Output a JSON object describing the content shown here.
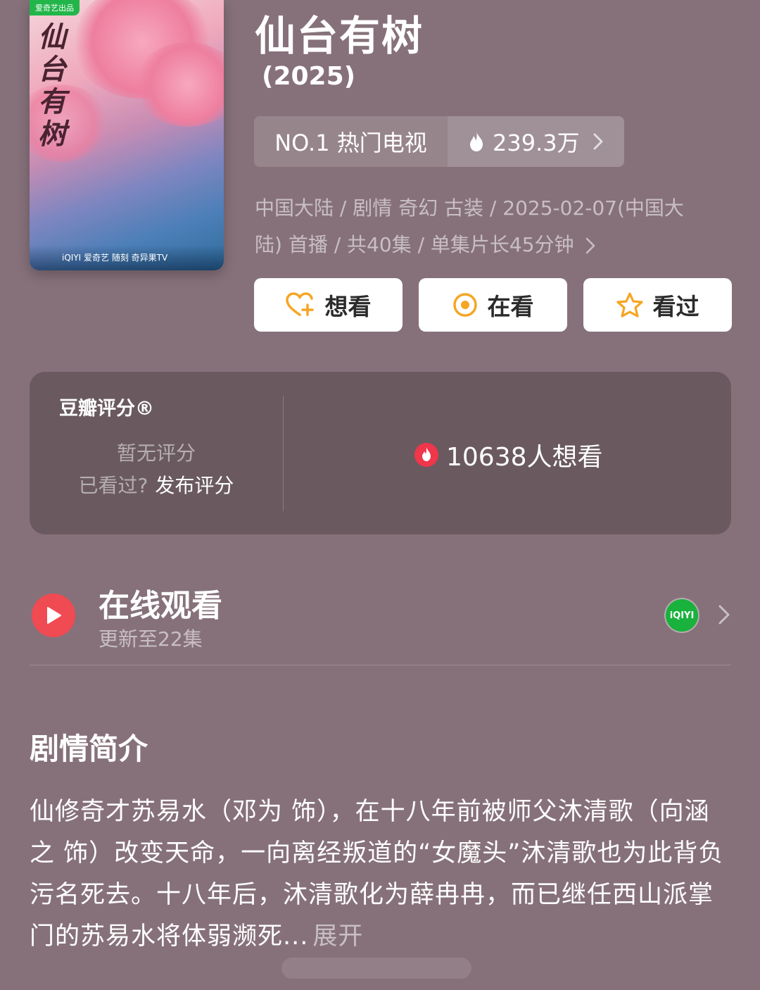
{
  "poster": {
    "badge": "爱奇艺出品",
    "title": "仙台有树",
    "bottom_text": "iQIYI 爱奇艺  随刻  奇异果TV"
  },
  "header": {
    "title": "仙台有树",
    "year": "(2025)"
  },
  "rank": {
    "label": "NO.1 热门电视",
    "heat": "239.3万"
  },
  "meta": {
    "line1": "中国大陆 / 剧情 奇幻 古装 / 2025-02-07(中国大",
    "line2": "陆) 首播 / 共40集 / 单集片长45分钟"
  },
  "actions": {
    "want": "想看",
    "watching": "在看",
    "watched": "看过"
  },
  "rating": {
    "label": "豆瓣评分®",
    "none": "暂无评分",
    "watched_q": "已看过?",
    "publish": "发布评分",
    "want_count": "10638人想看"
  },
  "online": {
    "title": "在线观看",
    "subtitle": "更新至22集",
    "provider": "iQIYI"
  },
  "synopsis": {
    "heading": "剧情简介",
    "text": "仙修奇才苏易水（邓为 饰），在十八年前被师父沐清歌（向涵之 饰）改变天命，一向离经叛道的“女魔头”沐清歌也为此背负污名死去。十八年后，沐清歌化为薛冉冉，而已继任西山派掌门的苏易水将体弱濒死...",
    "more": "展开"
  },
  "colors": {
    "background": "#86717a",
    "card": "#6a5a60",
    "play_red": "#f04a52",
    "iqiyi_green": "#19b23c",
    "icon_orange": "#f5a623"
  }
}
